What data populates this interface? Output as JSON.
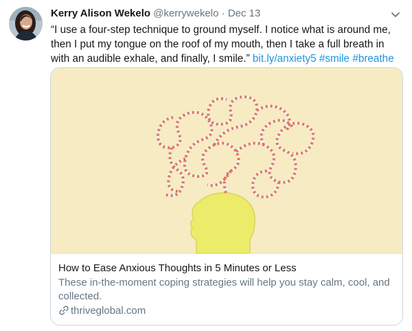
{
  "tweet": {
    "author": {
      "name": "Kerry Alison Wekelo",
      "handle": "@kerrywekelo",
      "avatar_icon": "profile-photo"
    },
    "separator": "·",
    "date": "Dec 13",
    "text": "“I use a four-step technique to ground myself. I notice what is around me, then I put my tongue on the roof of my mouth, then I take a full breath in with an audible exhale, and finally, I smile.”",
    "links": {
      "url": "bit.ly/anxiety5",
      "hashtag1": "#smile",
      "hashtag2": "#breathe"
    },
    "menu_icon": "chevron-down-icon",
    "colors": {
      "link": "#1b95e0",
      "secondary_text": "#657786",
      "border": "#ccd6dd"
    }
  },
  "card": {
    "image_description_icon": "tangled-string-head-image",
    "title": "How to Ease Anxious Thoughts in 5 Minutes or Less",
    "description": "These in-the-moment coping strategies will help you stay calm, cool, and collected.",
    "domain": "thriveglobal.com",
    "domain_icon": "link-icon"
  }
}
